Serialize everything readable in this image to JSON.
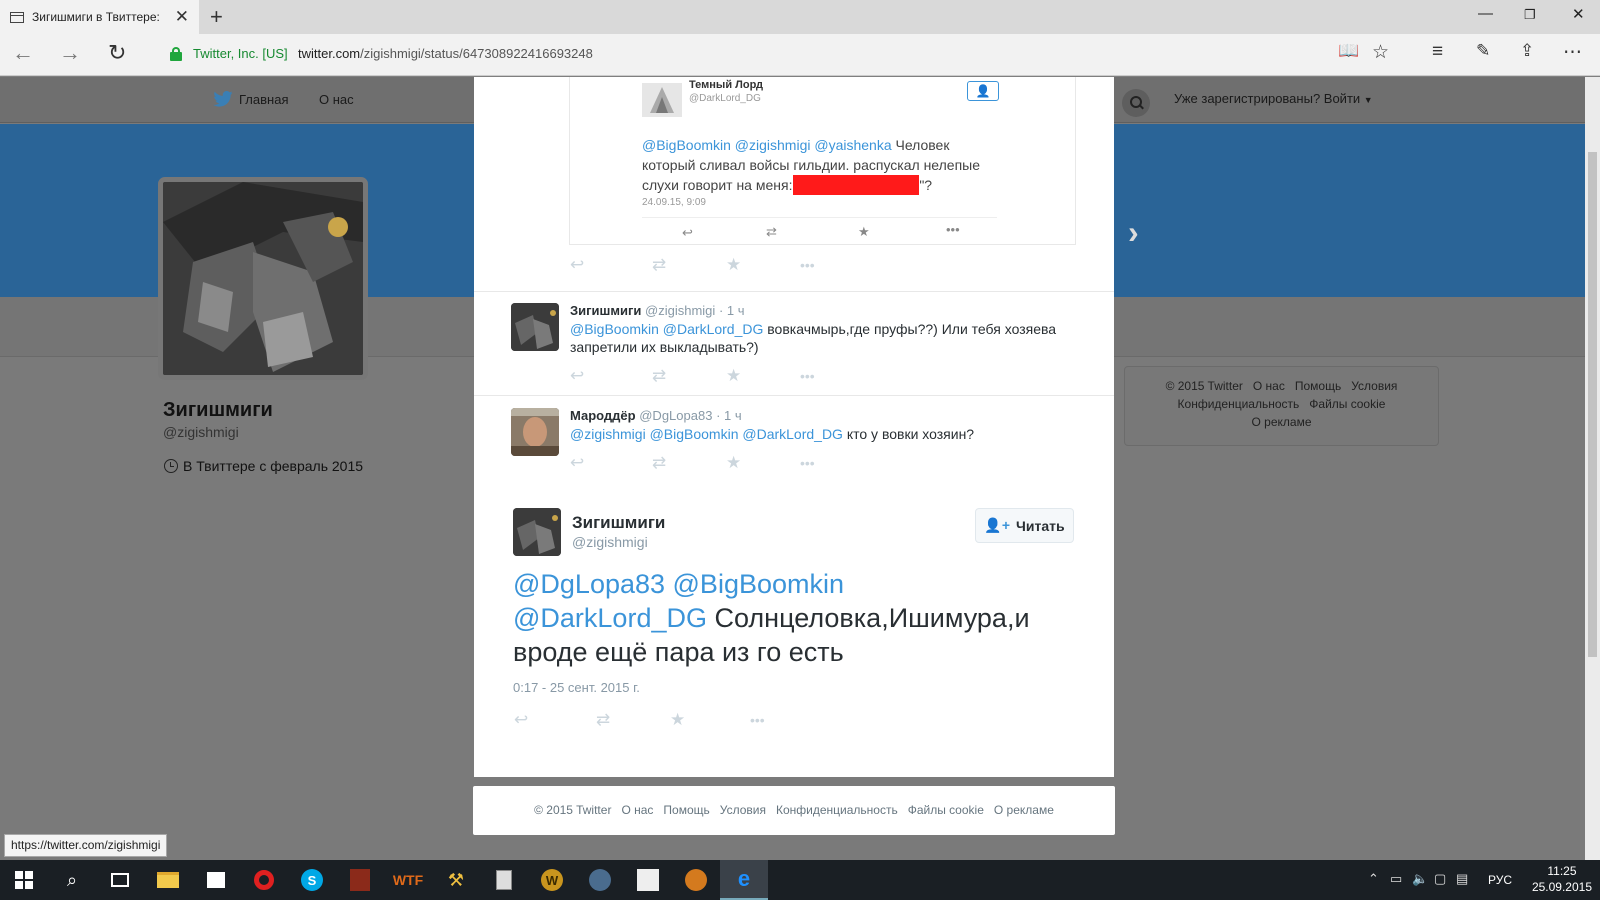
{
  "browser": {
    "tab_title": "Зигишмиги в Твиттере:",
    "cert": "Twitter, Inc. [US]",
    "url_domain": "twitter.com",
    "url_path": "/zigishmigi/status/647308922416693248",
    "status_url": "https://twitter.com/zigishmigi"
  },
  "twitter_nav": {
    "home": "Главная",
    "about": "О нас",
    "login": "Уже зарегистрированы? Войти"
  },
  "profile": {
    "name": "Зигишмиги",
    "handle": "@zigishmigi",
    "joined": "В Твиттере с февраль 2015"
  },
  "side_footer": {
    "items": [
      "© 2015 Twitter",
      "О нас",
      "Помощь",
      "Условия",
      "Конфиденциальность",
      "Файлы cookie",
      "О рекламе"
    ]
  },
  "quoted_screenshot": {
    "name": "Темный Лорд",
    "handle": "@DarkLord_DG",
    "mentions": "@BigBoomkin @zigishmigi @yaishenka",
    "text_line1": " Человек",
    "text_line2": "который сливал войсы гильдии. распускал нелепые",
    "text_line3": "слухи говорит на меня: \"",
    "text_line3_end": "\"?",
    "timestamp": "24.09.15, 9:09",
    "redaction_color": "#ff1a1a"
  },
  "replies": [
    {
      "name": "Зигишмиги",
      "handle": "@zigishmigi",
      "time": "· 1 ч",
      "mentions": "@BigBoomkin @DarkLord_DG",
      "text": "  вовкачмырь,где пруфы??) Или тебя хозяева запретили их выкладывать?)"
    },
    {
      "name": "Мароддёр",
      "handle": "@DgLopa83",
      "time": "· 1 ч",
      "mentions": "@zigishmigi @BigBoomkin @DarkLord_DG",
      "text": " кто у вовки хозяин?"
    }
  ],
  "main_tweet": {
    "name": "Зигишмиги",
    "handle": "@zigishmigi",
    "follow_label": "Читать",
    "mentions_line1": "@DgLopa83 @BigBoomkin",
    "mentions_line2": "@DarkLord_DG",
    "text_line2": " Солнцеловка,Ишимура,и",
    "text_line3": "вроде ещё пара из го есть",
    "timestamp": "0:17 - 25 сент. 2015 г."
  },
  "overlay_footer": {
    "items": [
      "© 2015 Twitter",
      "О нас",
      "Помощь",
      "Условия",
      "Конфиденциальность",
      "Файлы cookie",
      "О рекламе"
    ]
  },
  "taskbar": {
    "lang": "РУС",
    "time": "11:25",
    "date": "25.09.2015"
  },
  "colors": {
    "accent": "#3b94d9",
    "banner": "#2a6497",
    "twitter_bird": "#55acee"
  }
}
